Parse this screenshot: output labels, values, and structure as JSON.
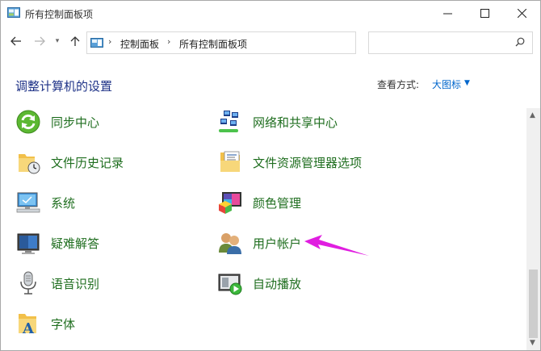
{
  "window": {
    "title": "所有控制面板项"
  },
  "nav": {
    "breadcrumbs": [
      "控制面板",
      "所有控制面板项"
    ],
    "search_placeholder": ""
  },
  "header": {
    "title": "调整计算机的设置",
    "view_by_label": "查看方式:",
    "view_by_value": "大图标"
  },
  "items": [
    {
      "label": "同步中心",
      "icon": "sync-center-icon"
    },
    {
      "label": "网络和共享中心",
      "icon": "network-sharing-icon"
    },
    {
      "label": "文件历史记录",
      "icon": "file-history-icon"
    },
    {
      "label": "文件资源管理器选项",
      "icon": "explorer-options-icon"
    },
    {
      "label": "系统",
      "icon": "system-icon"
    },
    {
      "label": "颜色管理",
      "icon": "color-management-icon"
    },
    {
      "label": "疑难解答",
      "icon": "troubleshooting-icon"
    },
    {
      "label": "用户帐户",
      "icon": "user-accounts-icon"
    },
    {
      "label": "语音识别",
      "icon": "speech-recognition-icon"
    },
    {
      "label": "自动播放",
      "icon": "autoplay-icon"
    },
    {
      "label": "字体",
      "icon": "fonts-icon"
    }
  ],
  "colors": {
    "link_green": "#1f6e1f",
    "title_blue": "#1e3287",
    "accent_blue": "#0066cc",
    "annotation_arrow": "#e01ee0"
  }
}
